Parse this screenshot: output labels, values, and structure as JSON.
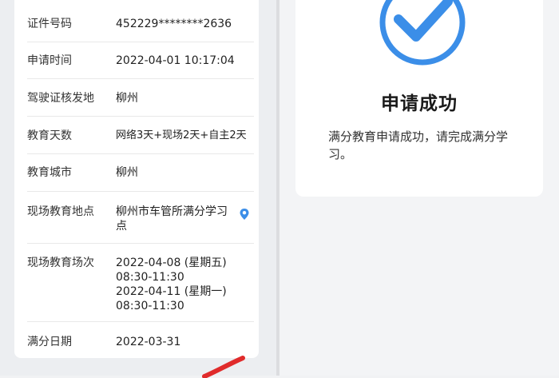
{
  "details": {
    "rows": [
      {
        "label": "证件号码",
        "value": "452229********2636"
      },
      {
        "label": "申请时间",
        "value": "2022-04-01 10:17:04"
      },
      {
        "label": "驾驶证核发地",
        "value": "柳州"
      },
      {
        "label": "教育天数",
        "value": "网络3天+现场2天+自主2天"
      },
      {
        "label": "教育城市",
        "value": "柳州"
      },
      {
        "label": "现场教育地点",
        "value": "柳州市车管所满分学习点",
        "icon": "location-pin-icon"
      },
      {
        "label": "现场教育场次",
        "value_lines": [
          "2022-04-08 (星期五)",
          "08:30-11:30",
          "2022-04-11 (星期一)",
          "08:30-11:30"
        ]
      },
      {
        "label": "满分日期",
        "value": "2022-03-31"
      }
    ]
  },
  "success": {
    "icon": "check-circle-icon",
    "title": "申请成功",
    "message": "满分教育申请成功，请完成满分学习。"
  },
  "colors": {
    "accent_blue": "#3b8ee8",
    "annotation_red": "#e02b2b"
  }
}
